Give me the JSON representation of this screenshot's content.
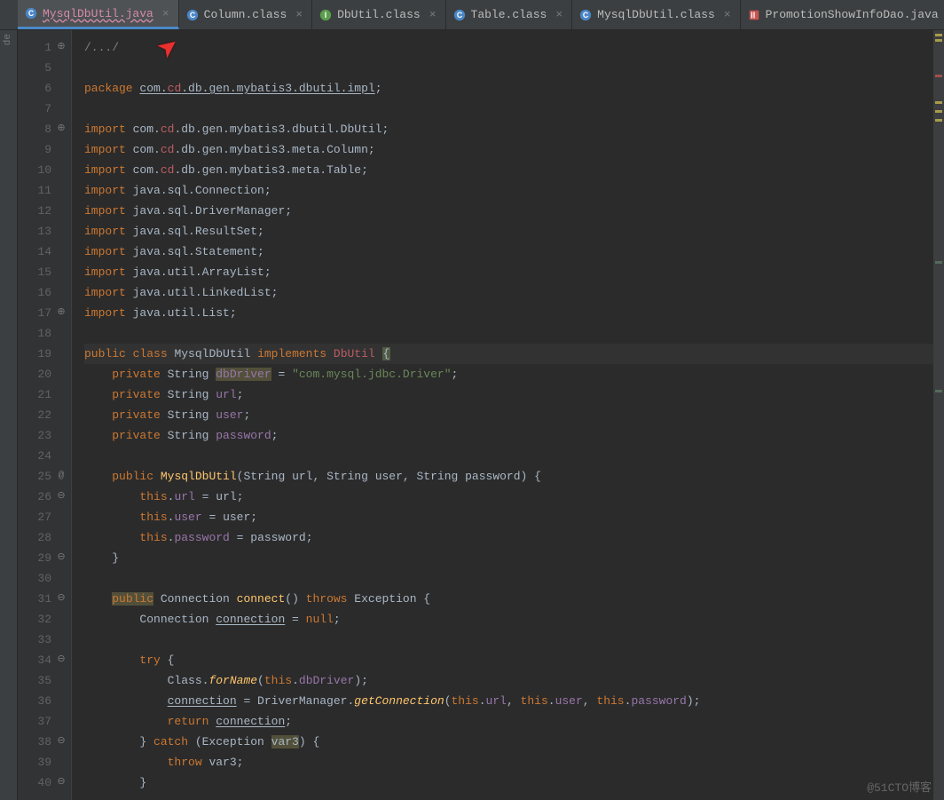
{
  "tabs": [
    {
      "label": "MysqlDbUtil.java",
      "kind": "class-c",
      "active": true
    },
    {
      "label": "Column.class",
      "kind": "class-c",
      "active": false
    },
    {
      "label": "DbUtil.class",
      "kind": "interface-i",
      "active": false
    },
    {
      "label": "Table.class",
      "kind": "class-c",
      "active": false
    },
    {
      "label": "MysqlDbUtil.class",
      "kind": "class-c",
      "active": false
    },
    {
      "label": "PromotionShowInfoDao.java",
      "kind": "xml",
      "active": false
    }
  ],
  "side_label": "de",
  "footer": "@51CTO博客",
  "lines": [
    {
      "n": 1,
      "ann": "⊕",
      "html": "<span class='grey'>/.../</span>"
    },
    {
      "n": 5,
      "html": ""
    },
    {
      "n": 6,
      "html": "<span class='kw'>package</span> <span class='uline'>com.<span class='err'>cd</span>.db.gen.mybatis3.dbutil.impl</span>;"
    },
    {
      "n": 7,
      "html": ""
    },
    {
      "n": 8,
      "ann": "⊕",
      "html": "<span class='kw'>import</span> com.<span class='err'>cd</span>.db.gen.mybatis3.dbutil.DbUtil;"
    },
    {
      "n": 9,
      "html": "<span class='kw'>import</span> com.<span class='err'>cd</span>.db.gen.mybatis3.meta.Column;"
    },
    {
      "n": 10,
      "html": "<span class='kw'>import</span> com.<span class='err'>cd</span>.db.gen.mybatis3.meta.Table;"
    },
    {
      "n": 11,
      "html": "<span class='kw'>import</span> java.sql.Connection;"
    },
    {
      "n": 12,
      "html": "<span class='kw'>import</span> java.sql.DriverManager;"
    },
    {
      "n": 13,
      "html": "<span class='kw'>import</span> java.sql.ResultSet;"
    },
    {
      "n": 14,
      "html": "<span class='kw'>import</span> java.sql.Statement;"
    },
    {
      "n": 15,
      "html": "<span class='kw'>import</span> java.util.ArrayList;"
    },
    {
      "n": 16,
      "html": "<span class='kw'>import</span> java.util.LinkedList;"
    },
    {
      "n": 17,
      "ann": "⊕",
      "html": "<span class='kw'>import</span> java.util.List;"
    },
    {
      "n": 18,
      "html": ""
    },
    {
      "n": 19,
      "hl": true,
      "html": "<span class='kw'>public class</span> <span class='type'>MysqlDbUtil</span> <span class='kw'>implements</span> <span class='err'>DbUtil</span> <span class='hlbox'>{</span>"
    },
    {
      "n": 20,
      "html": "    <span class='kw'>private</span> String <span class='errbox field'>dbDriver</span> = <span class='str'>\"com.mysql.jdbc.Driver\"</span>;"
    },
    {
      "n": 21,
      "html": "    <span class='kw'>private</span> String <span class='field'>url</span>;"
    },
    {
      "n": 22,
      "html": "    <span class='kw'>private</span> String <span class='field'>user</span>;"
    },
    {
      "n": 23,
      "html": "    <span class='kw'>private</span> String <span class='field'>password</span>;"
    },
    {
      "n": 24,
      "html": ""
    },
    {
      "n": 25,
      "ann": "@ ⊖",
      "html": "    <span class='kw'>public</span> <span class='fname2'>MysqlDbUtil</span>(String url, String user, String password) {"
    },
    {
      "n": 26,
      "html": "        <span class='kw'>this</span>.<span class='field'>url</span> = url;"
    },
    {
      "n": 27,
      "html": "        <span class='kw'>this</span>.<span class='field'>user</span> = user;"
    },
    {
      "n": 28,
      "html": "        <span class='kw'>this</span>.<span class='field'>password</span> = password;"
    },
    {
      "n": 29,
      "ann": "⊖",
      "html": "    }"
    },
    {
      "n": 30,
      "html": ""
    },
    {
      "n": 31,
      "ann": "⊖",
      "html": "    <span class='errbox kw'>public</span> Connection <span class='fname2'>connect</span>() <span class='kw'>throws</span> Exception {"
    },
    {
      "n": 32,
      "html": "        Connection <span class='uline'>connection</span> = <span class='kw'>null</span>;"
    },
    {
      "n": 33,
      "html": ""
    },
    {
      "n": 34,
      "ann": "⊖",
      "html": "        <span class='kw'>try</span> {"
    },
    {
      "n": 35,
      "html": "            Class.<span class='fname'>forName</span>(<span class='kw'>this</span>.<span class='field'>dbDriver</span>);"
    },
    {
      "n": 36,
      "html": "            <span class='uline'>connection</span> = DriverManager.<span class='fname'>getConnection</span>(<span class='kw'>this</span>.<span class='field'>url</span>, <span class='kw'>this</span>.<span class='field'>user</span>, <span class='kw'>this</span>.<span class='field'>password</span>);"
    },
    {
      "n": 37,
      "html": "            <span class='kw'>return</span> <span class='uline'>connection</span>;"
    },
    {
      "n": 38,
      "ann": "⊖",
      "html": "        } <span class='kw'>catch</span> (Exception <span class='errbox'>var3</span>) {"
    },
    {
      "n": 39,
      "html": "            <span class='kw'>throw</span> var3;"
    },
    {
      "n": 40,
      "ann": "⊖",
      "html": "        }"
    }
  ]
}
